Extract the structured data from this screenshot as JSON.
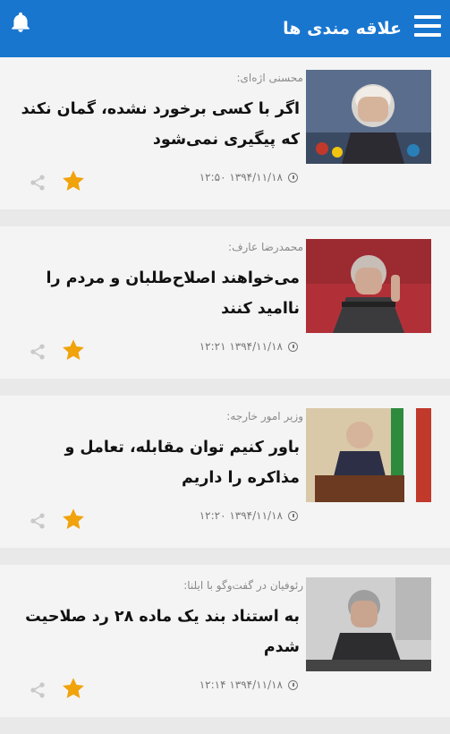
{
  "header": {
    "title": "علاقه مندی ها"
  },
  "articles": [
    {
      "source": "محسنی اژه‌ای:",
      "headline": "اگر با کسی برخورد نشده، گمان نکند که پیگیری نمی‌شود",
      "datetime": "۱۳۹۴/۱۱/۱۸  ۱۲:۵۰",
      "photo_colors": [
        "#5a6d8c",
        "#d8d4cf",
        "#2c2b31"
      ]
    },
    {
      "source": "محمدرضا عارف:",
      "headline": "می‌خواهند اصلاح‌طلبان و مردم را ناامید کنند",
      "datetime": "۱۳۹۴/۱۱/۱۸  ۱۲:۲۱",
      "photo_colors": [
        "#b13037",
        "#c8beb8",
        "#3b3b3e"
      ]
    },
    {
      "source": "وزیر امور خارجه:",
      "headline": "باور کنیم توان مقابله، تعامل و مذاکره را داریم",
      "datetime": "۱۳۹۴/۱۱/۱۸  ۱۲:۲۰",
      "photo_colors": [
        "#d9c9a8",
        "#2c2f45",
        "#6b3a20"
      ]
    },
    {
      "source": "رئوفیان در گفت‌وگو با ایلنا:",
      "headline": "به استناد بند یک ماده ۲۸ رد صلاحیت شدم",
      "datetime": "۱۳۹۴/۱۱/۱۸  ۱۲:۱۴",
      "photo_colors": [
        "#cfcfcf",
        "#2d2d30",
        "#9e9e9e"
      ]
    }
  ],
  "icons": {
    "menu": "hamburger-icon",
    "bell": "bell-icon",
    "star": "star-icon",
    "share": "share-icon",
    "clock": "clock-icon"
  },
  "colors": {
    "header_bg": "#1876cf",
    "star": "#f0a30a",
    "share": "#c9c9c9"
  }
}
